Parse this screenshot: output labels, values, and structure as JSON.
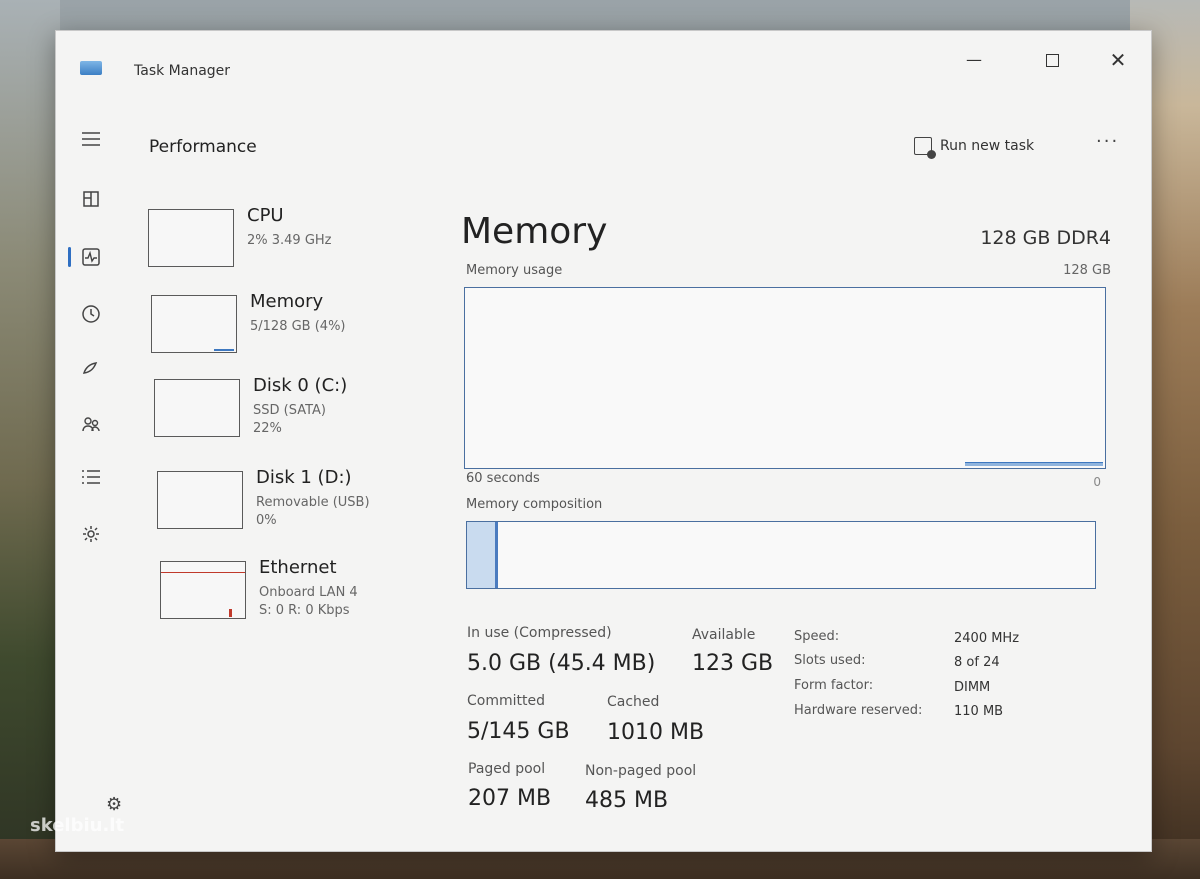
{
  "window": {
    "title": "Task Manager",
    "minimize": "—",
    "close": "✕"
  },
  "sidebar": {
    "icons": [
      "hamburger-icon",
      "processes-icon",
      "performance-icon",
      "app-history-icon",
      "startup-icon",
      "users-icon",
      "details-icon",
      "services-icon",
      "settings-icon"
    ]
  },
  "header": {
    "title": "Performance",
    "run_new_task": "Run new task",
    "more": "···"
  },
  "perf_list": [
    {
      "name": "CPU",
      "line1": "2% 3.49 GHz",
      "line2": ""
    },
    {
      "name": "Memory",
      "line1": "5/128 GB (4%)",
      "line2": ""
    },
    {
      "name": "Disk 0 (C:)",
      "line1": "SSD (SATA)",
      "line2": "22%"
    },
    {
      "name": "Disk 1 (D:)",
      "line1": "Removable (USB)",
      "line2": "0%"
    },
    {
      "name": "Ethernet",
      "line1": "Onboard LAN 4",
      "line2": "S: 0 R: 0 Kbps"
    }
  ],
  "memory": {
    "title": "Memory",
    "type": "128 GB DDR4",
    "usage_label": "Memory usage",
    "usage_max": "128 GB",
    "graph_left": "60 seconds",
    "graph_right": "0",
    "composition_label": "Memory composition",
    "in_use_fraction": 0.04,
    "stats": {
      "in_use_label": "In use (Compressed)",
      "in_use_value": "5.0 GB (45.4 MB)",
      "available_label": "Available",
      "available_value": "123 GB",
      "committed_label": "Committed",
      "committed_value": "5/145 GB",
      "cached_label": "Cached",
      "cached_value": "1010 MB",
      "paged_label": "Paged pool",
      "paged_value": "207 MB",
      "nonpaged_label": "Non-paged pool",
      "nonpaged_value": "485 MB"
    },
    "details": {
      "speed_label": "Speed:",
      "speed_value": "2400 MHz",
      "slots_label": "Slots used:",
      "slots_value": "8 of 24",
      "form_label": "Form factor:",
      "form_value": "DIMM",
      "reserved_label": "Hardware reserved:",
      "reserved_value": "110 MB"
    }
  },
  "watermark": "skelbiu.lt",
  "colors": {
    "accent": "#2f6fc2",
    "memory_graph": "#4a6fa0",
    "ethernet_graph": "#c0392b"
  }
}
